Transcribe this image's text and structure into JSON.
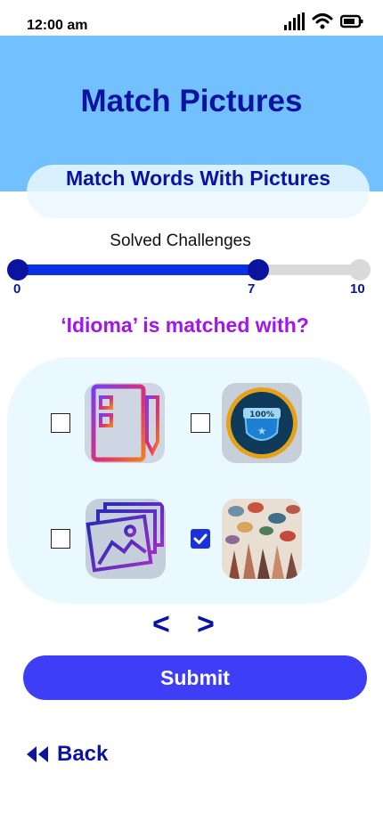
{
  "status_bar": {
    "time": "12:00 am",
    "icons": [
      "signal-icon",
      "wifi-icon",
      "battery-icon"
    ]
  },
  "header": {
    "title": "Match Pictures",
    "subtitle": "Match  Words With Pictures"
  },
  "progress": {
    "label": "Solved Challenges",
    "min": "0",
    "current": "7",
    "max": "10",
    "fraction": 0.7
  },
  "question": "‘Idioma’  is matched with?",
  "options": [
    {
      "icon": "document-pencil-icon",
      "checked": false
    },
    {
      "icon": "badge-100-percent-icon",
      "checked": false
    },
    {
      "icon": "photo-gallery-icon",
      "checked": false
    },
    {
      "icon": "speech-bubbles-people-icon",
      "checked": true
    }
  ],
  "pager": {
    "prev": "<",
    "next": ">"
  },
  "submit_label": "Submit",
  "back_label": "Back",
  "colors": {
    "header": "#73c0fe",
    "accent": "#3d3ef6",
    "title": "#0a14a0",
    "question": "#a215ec",
    "progress": "#0b31e6"
  }
}
